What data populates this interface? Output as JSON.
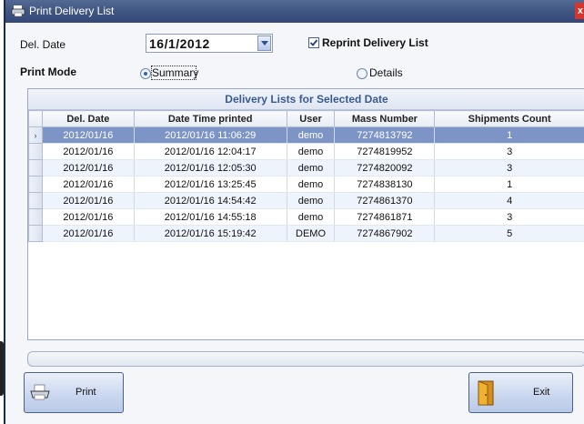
{
  "window": {
    "title": "Print Delivery List",
    "close_glyph": "x",
    "title_icon": "printer-icon"
  },
  "form": {
    "del_date_label": "Del. Date",
    "del_date_value": "16/1/2012",
    "reprint_label": "Reprint Delivery List",
    "reprint_checked": true,
    "print_mode_label": "Print Mode",
    "summary_label": "Summary",
    "details_label": "Details",
    "selected_mode": "Summary"
  },
  "grid": {
    "title": "Delivery Lists for Selected Date",
    "columns": [
      "Del. Date",
      "Date Time printed",
      "User",
      "Mass Number",
      "Shipments Count"
    ],
    "rows": [
      {
        "del_date": "2012/01/16",
        "printed": "2012/01/16 11:06:29",
        "user": "demo",
        "mass": "7274813792",
        "count": "1"
      },
      {
        "del_date": "2012/01/16",
        "printed": "2012/01/16 12:04:17",
        "user": "demo",
        "mass": "7274819952",
        "count": "3"
      },
      {
        "del_date": "2012/01/16",
        "printed": "2012/01/16 12:05:30",
        "user": "demo",
        "mass": "7274820092",
        "count": "3"
      },
      {
        "del_date": "2012/01/16",
        "printed": "2012/01/16 13:25:45",
        "user": "demo",
        "mass": "7274838130",
        "count": "1"
      },
      {
        "del_date": "2012/01/16",
        "printed": "2012/01/16 14:54:42",
        "user": "demo",
        "mass": "7274861370",
        "count": "4"
      },
      {
        "del_date": "2012/01/16",
        "printed": "2012/01/16 14:55:18",
        "user": "demo",
        "mass": "7274861871",
        "count": "3"
      },
      {
        "del_date": "2012/01/16",
        "printed": "2012/01/16 15:19:42",
        "user": "DEMO",
        "mass": "7274867902",
        "count": "5"
      }
    ],
    "selected_row": 0,
    "row_indicator": "›"
  },
  "buttons": {
    "print_label": "Print",
    "print_icon": "printer-icon",
    "exit_label": "Exit",
    "exit_icon": "door-exit-icon"
  },
  "colors": {
    "titlebar": "#3e5480",
    "selection": "#7c95c6",
    "header_text": "#3a5a94",
    "close": "#d9342b"
  }
}
